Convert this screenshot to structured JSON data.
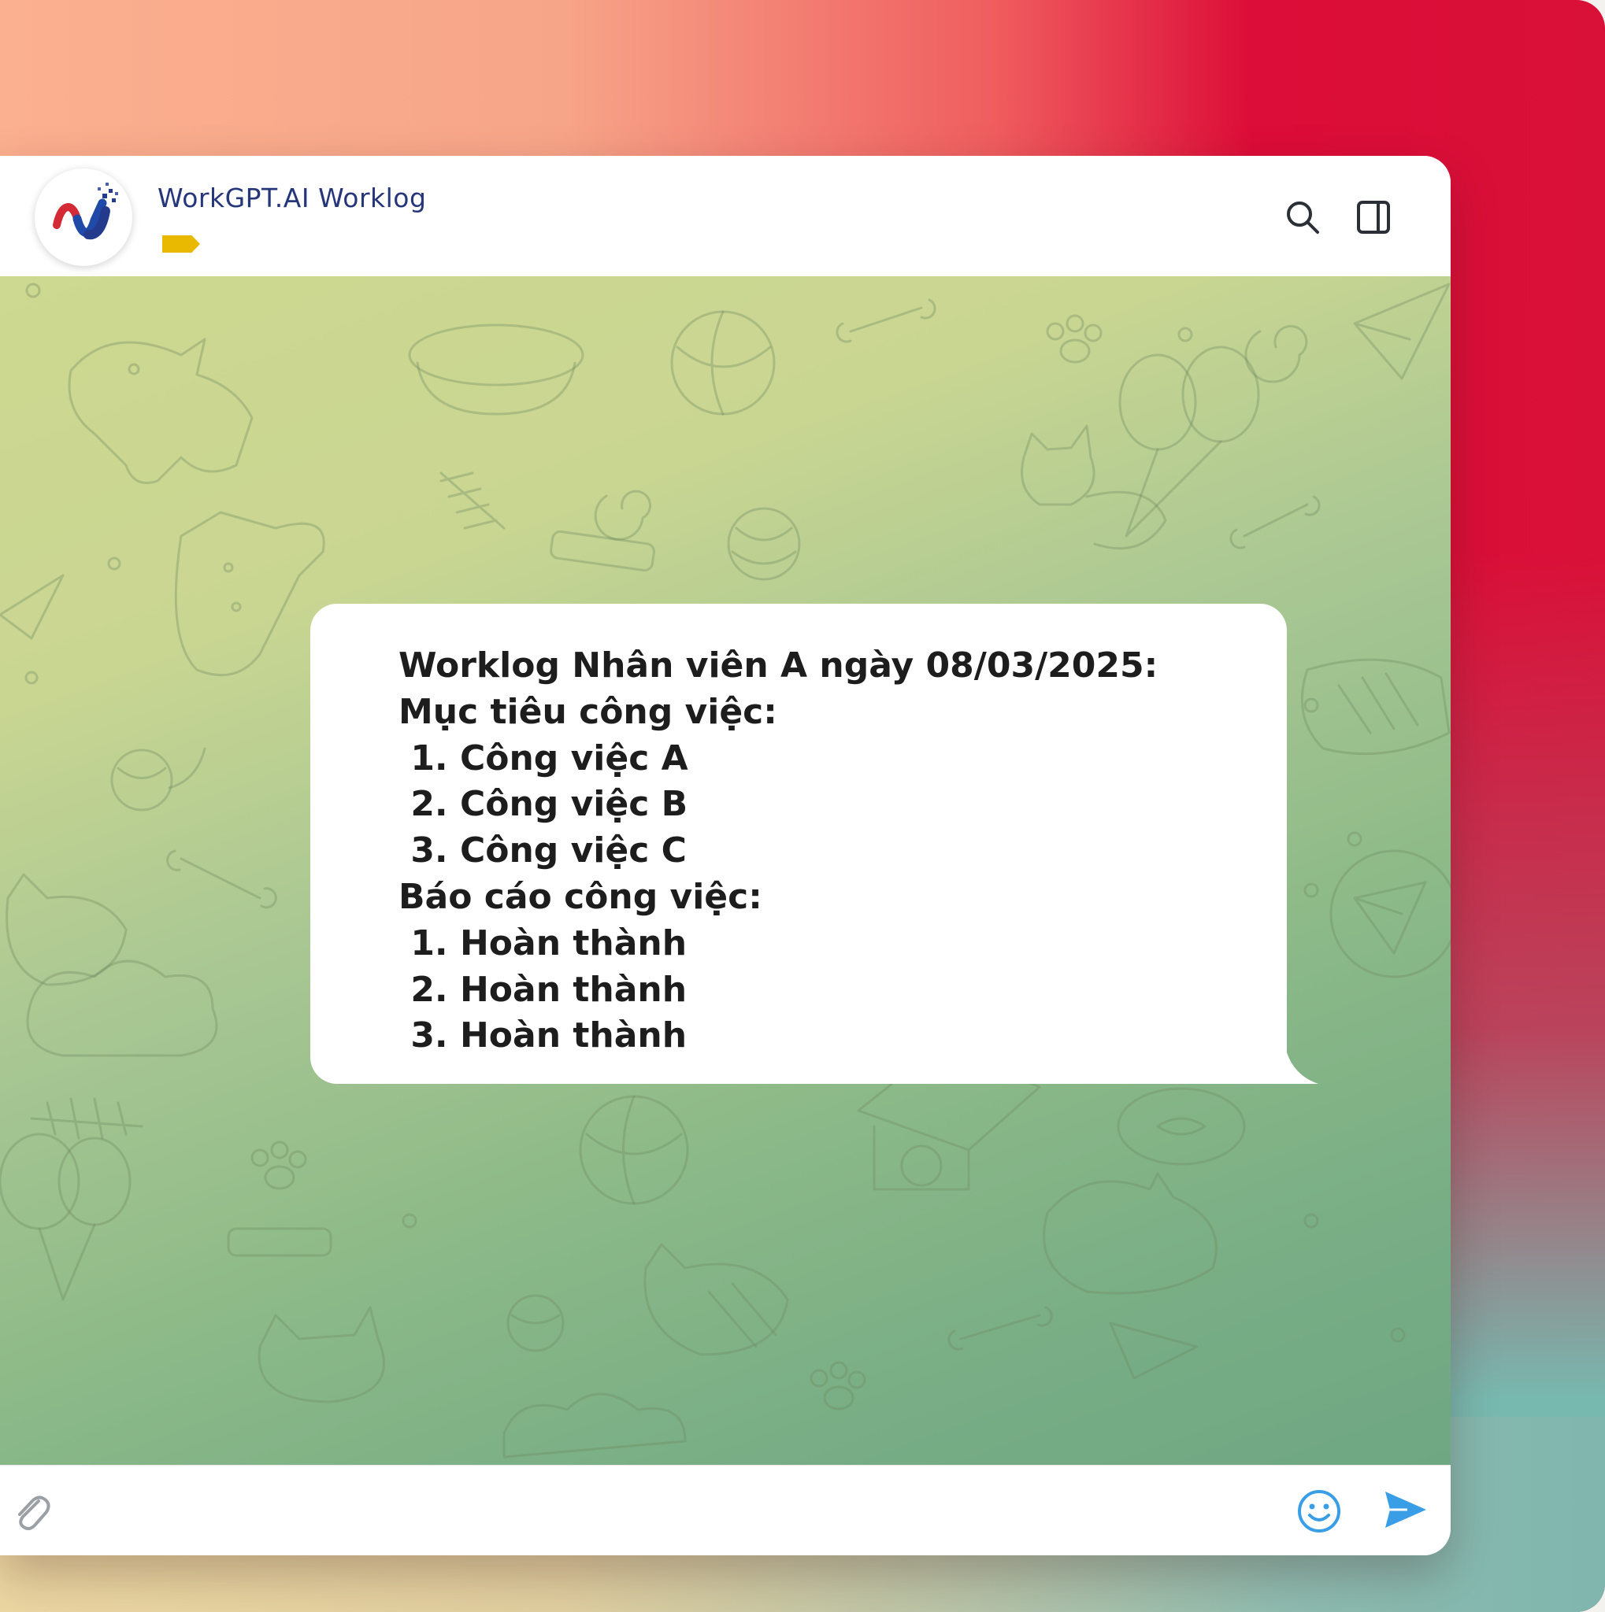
{
  "header": {
    "title": "WorkGPT.AI Worklog"
  },
  "message": {
    "lines": [
      "Worklog Nhân viên A ngày 08/03/2025:",
      "Mục tiêu công việc:",
      " 1. Công việc A",
      " 2. Công việc B",
      " 3. Công việc C",
      "Báo cáo công việc:",
      " 1. Hoàn thành",
      " 2. Hoàn thành",
      " 3. Hoàn thành"
    ]
  },
  "input": {
    "placeholder": ""
  },
  "colors": {
    "title": "#26367a",
    "tag": "#e9b800",
    "send": "#3a9ee6"
  },
  "icons": [
    "logo-icon",
    "search-icon",
    "sidebar-toggle-icon",
    "attach-icon",
    "emoji-icon",
    "send-icon"
  ]
}
